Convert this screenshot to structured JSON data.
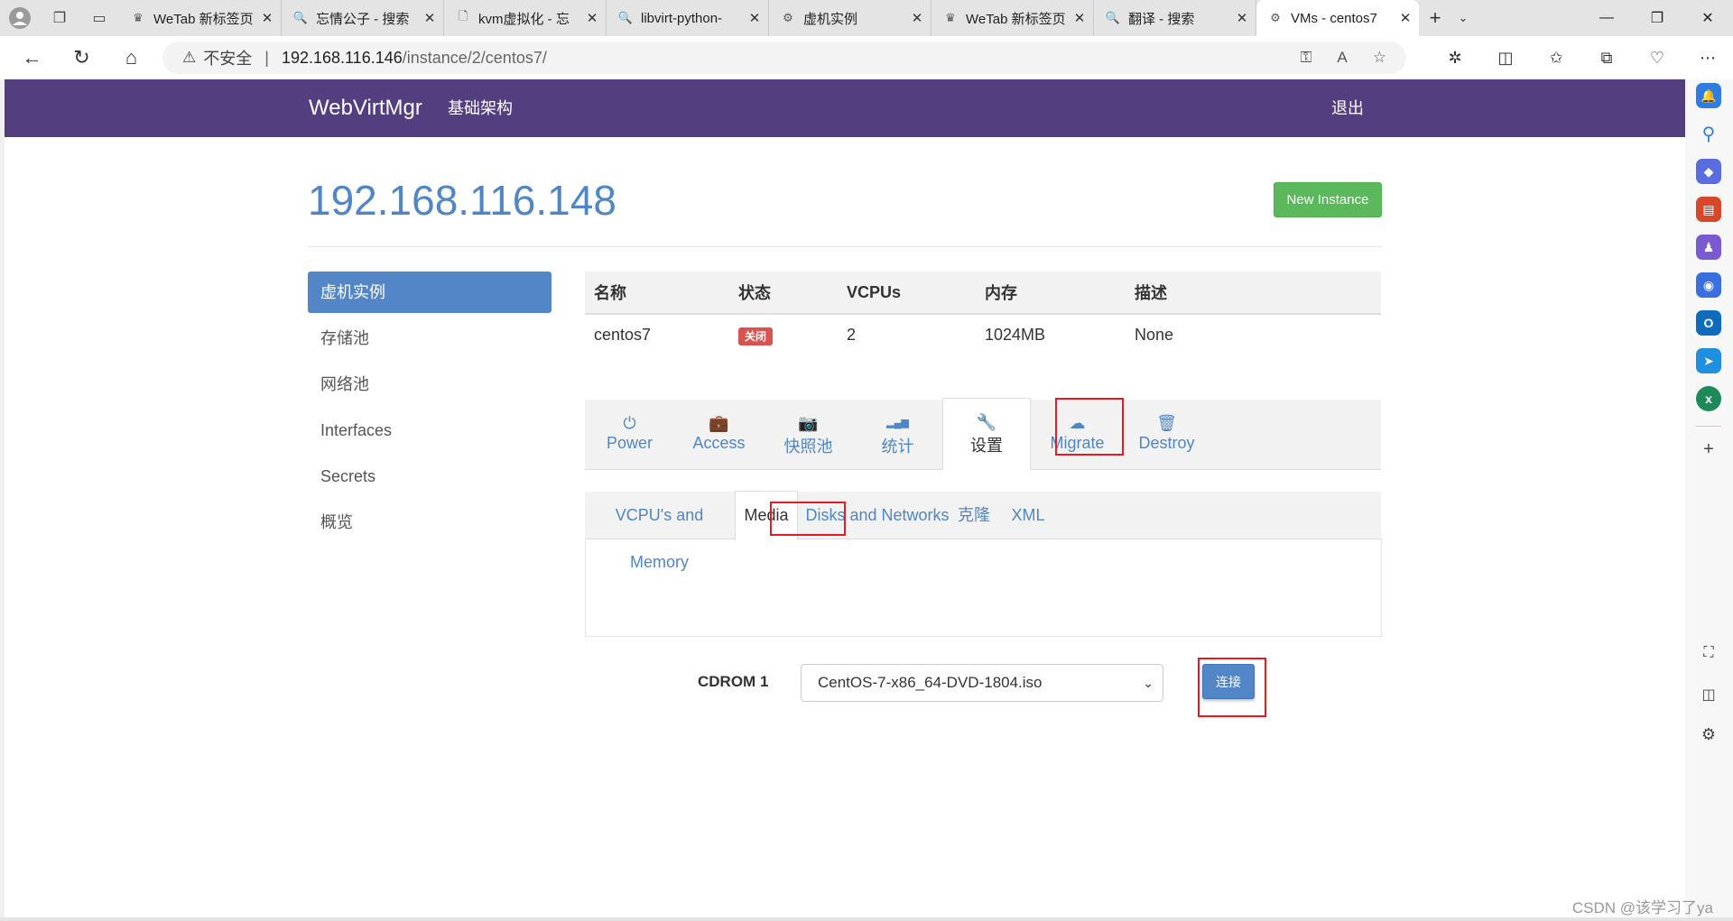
{
  "browser": {
    "tabs": [
      {
        "icon": "crown-icon",
        "glyph": "♛",
        "title": "WeTab 新标签页"
      },
      {
        "icon": "search-icon",
        "glyph": "🔍",
        "title": "忘情公子 - 搜索"
      },
      {
        "icon": "document-icon",
        "glyph": "🗋",
        "title": "kvm虚拟化 - 忘"
      },
      {
        "icon": "search-icon",
        "glyph": "🔍",
        "title": "libvirt-python-"
      },
      {
        "icon": "webvirt-icon",
        "glyph": "⚙",
        "title": "虚机实例"
      },
      {
        "icon": "crown-icon",
        "glyph": "♛",
        "title": "WeTab 新标签页"
      },
      {
        "icon": "search-icon",
        "glyph": "🔍",
        "title": "翻译 - 搜索"
      },
      {
        "icon": "webvirt-icon",
        "glyph": "⚙",
        "title": "VMs - centos7",
        "active": true
      }
    ],
    "address": {
      "security_label": "不安全",
      "host": "192.168.116.146",
      "path": "/instance/2/centos7/"
    }
  },
  "header": {
    "brand": "WebVirtMgr",
    "nav_link": "基础架构",
    "logout": "退出"
  },
  "page": {
    "title": "192.168.116.148",
    "new_instance_label": "New Instance"
  },
  "menu": {
    "items": [
      {
        "label": "虚机实例",
        "active": true
      },
      {
        "label": "存储池"
      },
      {
        "label": "网络池"
      },
      {
        "label": "Interfaces"
      },
      {
        "label": "Secrets"
      },
      {
        "label": "概览"
      }
    ]
  },
  "table": {
    "headers": [
      "名称",
      "状态",
      "VCPUs",
      "内存",
      "描述"
    ],
    "row": {
      "name": "centos7",
      "status": "关闭",
      "vcpus": "2",
      "memory": "1024MB",
      "description": "None"
    }
  },
  "actions": [
    {
      "label": "Power",
      "icon": "power-icon"
    },
    {
      "label": "Access",
      "icon": "briefcase-icon"
    },
    {
      "label": "快照池",
      "icon": "camera-icon"
    },
    {
      "label": "统计",
      "icon": "signal-icon"
    },
    {
      "label": "设置",
      "icon": "wrench-icon",
      "active": true
    },
    {
      "label": "Migrate",
      "icon": "cloud-upload-icon"
    },
    {
      "label": "Destroy",
      "icon": "trash-icon"
    }
  ],
  "subtabs": [
    {
      "label": "VCPU's and Memory"
    },
    {
      "label": "Media",
      "active": true
    },
    {
      "label": "Disks and Networks"
    },
    {
      "label": "克隆"
    },
    {
      "label": "XML"
    }
  ],
  "media": {
    "cdrom_label": "CDROM 1",
    "selected_iso": "CentOS-7-x86_64-DVD-1804.iso",
    "connect_label": "连接"
  },
  "watermark": "CSDN @该学习了ya",
  "colors": {
    "navbar": "#533e7f",
    "link": "#4f86c6",
    "primary": "#5286c7",
    "success": "#5cb85c",
    "danger": "#d9534f",
    "annotation": "#e51b23"
  }
}
